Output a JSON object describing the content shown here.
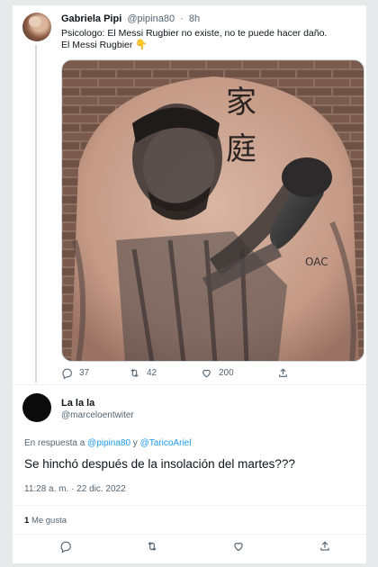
{
  "tweet1": {
    "name": "Gabriela Pipi",
    "handle": "@pipina80",
    "separator": "·",
    "time": "8h",
    "text_line1": "Psicologo: El Messi Rugbier no existe, no te puede hacer daño.",
    "text_line2": "El Messi Rugbier",
    "emoji": "👇",
    "photo_glyph_top": "家",
    "photo_glyph_bottom": "庭",
    "photo_tattoo_text": "OAC",
    "replies": "37",
    "retweets": "42",
    "likes": "200"
  },
  "tweet2": {
    "name": "La la la",
    "handle": "@marceloentwiter",
    "reply_prefix": "En respuesta a",
    "mention1": "@pipina80",
    "reply_and": "y",
    "mention2": "@TaricoAriel",
    "text": "Se hinchó después de la insolación del martes???",
    "timestamp": "11:28 a. m. · 22 dic. 2022",
    "likes_count": "1",
    "likes_label": "Me gusta"
  },
  "colors": {
    "accent": "#1d9bf0",
    "muted": "#536471",
    "text": "#0f1419",
    "border": "#eff3f4"
  },
  "icons": {
    "reply": "reply-icon",
    "retweet": "retweet-icon",
    "like": "heart-icon",
    "share": "share-icon"
  }
}
